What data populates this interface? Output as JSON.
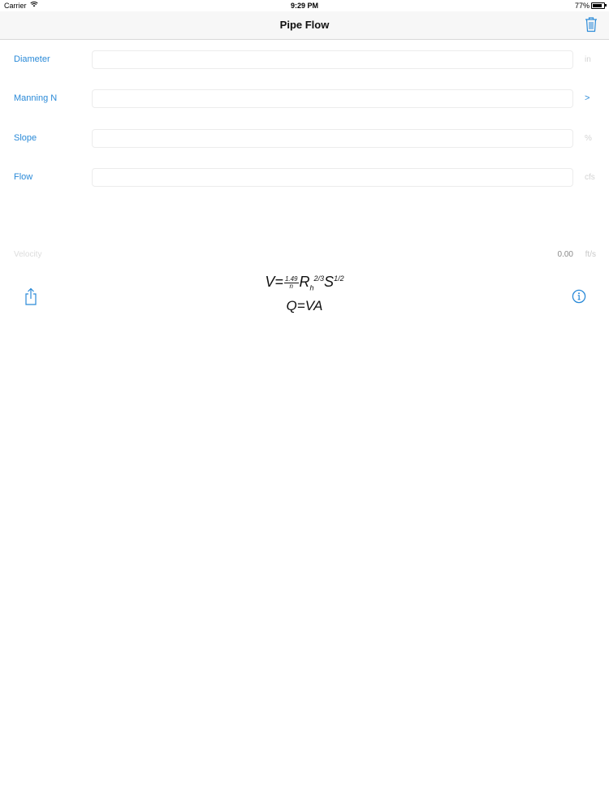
{
  "status_bar": {
    "carrier": "Carrier",
    "time": "9:29 PM",
    "battery": "77%"
  },
  "nav": {
    "title": "Pipe Flow",
    "trash_icon": "trash-icon"
  },
  "form": {
    "diameter": {
      "label": "Diameter",
      "value": "",
      "unit": "in"
    },
    "manning": {
      "label": "Manning N",
      "value": "",
      "unit": ">"
    },
    "slope": {
      "label": "Slope",
      "value": "",
      "unit": "%"
    },
    "flow": {
      "label": "Flow",
      "value": "",
      "unit": "cfs"
    }
  },
  "result": {
    "label": "Velocity",
    "value": "0.00",
    "unit": "ft/s"
  },
  "formula": {
    "v_prefix": "V=",
    "frac_num": "1.49",
    "frac_den": "n",
    "r": "R",
    "r_sup": "2/3",
    "r_sub": "h",
    "s": "S",
    "s_sup": "1/2",
    "q": "Q=VA"
  },
  "colors": {
    "accent": "#2a8ad8",
    "navbar_bg": "#f7f7f7"
  }
}
